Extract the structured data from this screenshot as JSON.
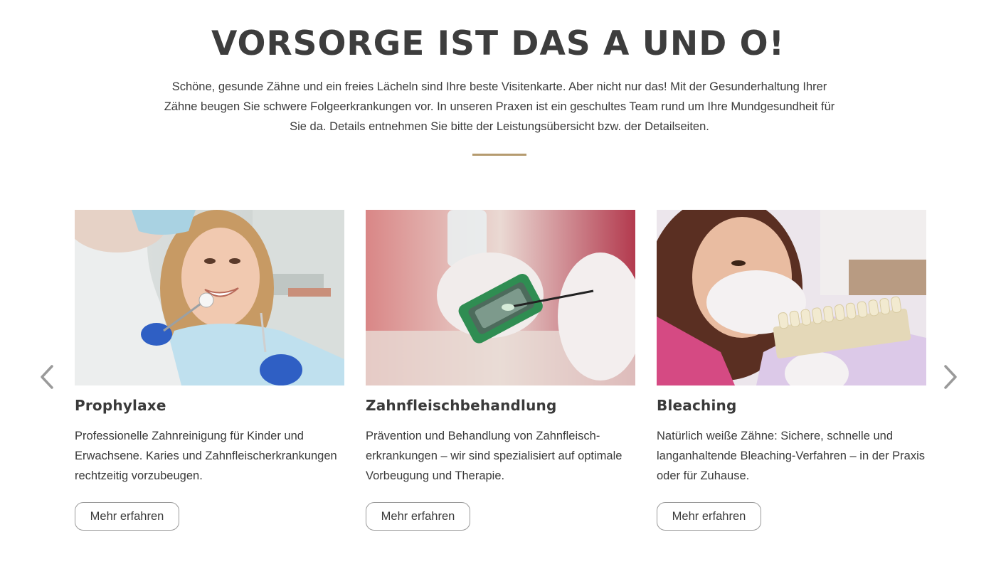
{
  "section": {
    "heading": "VORSORGE IST DAS A UND O!",
    "intro": "Schöne, gesunde Zähne und ein freies Lächeln sind Ihre beste Visitenkarte. Aber nicht nur das! Mit der Gesunderhaltung Ihrer Zähne beugen Sie schwere Folgeerkrankungen vor. In unseren Praxen ist ein geschultes Team rund um Ihre Mundgesundheit für Sie da. Details entnehmen Sie bitte der Leistungsübersicht bzw. der Detailseiten.",
    "accent_color": "#b59b6f"
  },
  "carousel": {
    "prev_icon": "chevron-left-icon",
    "next_icon": "chevron-right-icon",
    "cards": [
      {
        "title": "Prophylaxe",
        "text": "Professionelle Zahnreinigung für Kinder und Erwachsene. Karies und Zahnfleischerkrankungen rechtzeitig vorzubeugen.",
        "button": "Mehr erfahren",
        "image": "dentist-patient-smiling-photo"
      },
      {
        "title": "Zahnfleischbehandlung",
        "text": "Prävention und Behandlung von Zahnfleisch-erkrankungen – wir sind spezialisiert auf optimale Vorbeugung und Therapie.",
        "button": "Mehr erfahren",
        "image": "gum-test-sample-photo"
      },
      {
        "title": "Bleaching",
        "text": "Natürlich weiße Zähne: Sichere, schnelle und langanhaltende Bleaching-Verfahren – in der Praxis oder für Zuhause.",
        "button": "Mehr erfahren",
        "image": "tooth-shade-guide-photo"
      }
    ]
  }
}
